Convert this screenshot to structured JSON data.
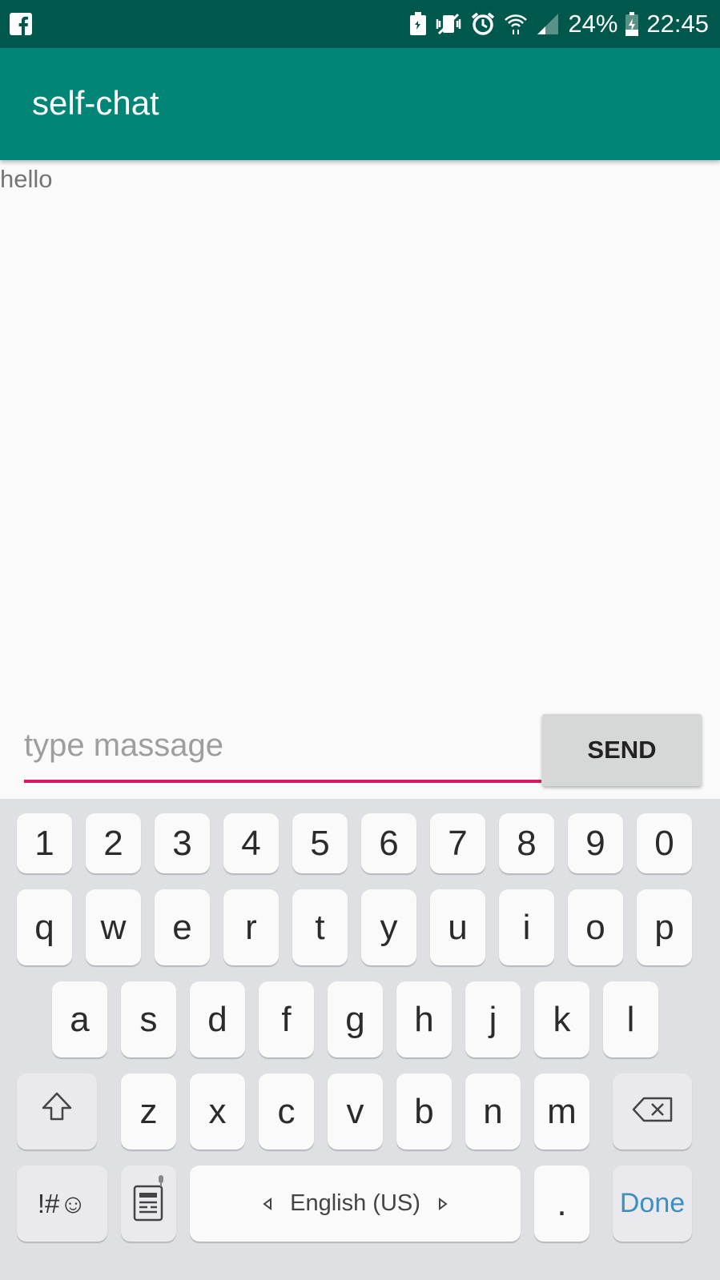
{
  "status_bar": {
    "battery_percent": "24%",
    "time": "22:45",
    "icons": [
      "facebook-icon",
      "battery-saver-icon",
      "vibrate-icon",
      "alarm-icon",
      "wifi-icon",
      "signal-icon",
      "battery-icon"
    ]
  },
  "app_bar": {
    "title": "self-chat",
    "color": "#008577"
  },
  "chat": {
    "messages": [
      "hello"
    ]
  },
  "composer": {
    "placeholder": "type massage",
    "value": "",
    "send_label": "SEND",
    "accent": "#d81b60"
  },
  "keyboard": {
    "row1": [
      "1",
      "2",
      "3",
      "4",
      "5",
      "6",
      "7",
      "8",
      "9",
      "0"
    ],
    "row2": [
      "q",
      "w",
      "e",
      "r",
      "t",
      "y",
      "u",
      "i",
      "o",
      "p"
    ],
    "row3": [
      "a",
      "s",
      "d",
      "f",
      "g",
      "h",
      "j",
      "k",
      "l"
    ],
    "row4": [
      "z",
      "x",
      "c",
      "v",
      "b",
      "n",
      "m"
    ],
    "symbols_label": "!#☺",
    "space_label": "English (US)",
    "period_label": ".",
    "done_label": "Done"
  }
}
